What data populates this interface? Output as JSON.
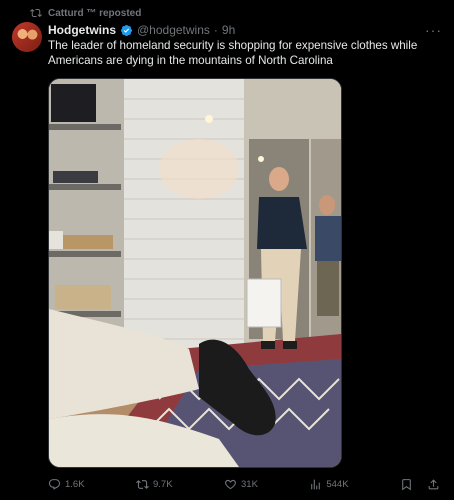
{
  "repost": {
    "text": "Catturd ™ reposted"
  },
  "tweet": {
    "name": "Hodgetwins",
    "handle": "@hodgetwins",
    "dot": "·",
    "time": "9h",
    "text": "The leader of homeland security is shopping for expensive clothes while Americans are dying in the mountains of North Carolina",
    "more": "···"
  },
  "actions": {
    "replies": "1.6K",
    "reposts": "9.7K",
    "likes": "31K",
    "views": "544K"
  },
  "icons": {
    "repost": "repost-icon",
    "verified": "verified-badge-icon",
    "reply": "reply-icon",
    "like": "heart-icon",
    "views": "views-icon",
    "bookmark": "bookmark-icon",
    "share": "share-icon"
  },
  "colors": {
    "background": "#000000",
    "text": "#e7e9ea",
    "muted": "#71767b",
    "verified": "#1d9bf0"
  }
}
